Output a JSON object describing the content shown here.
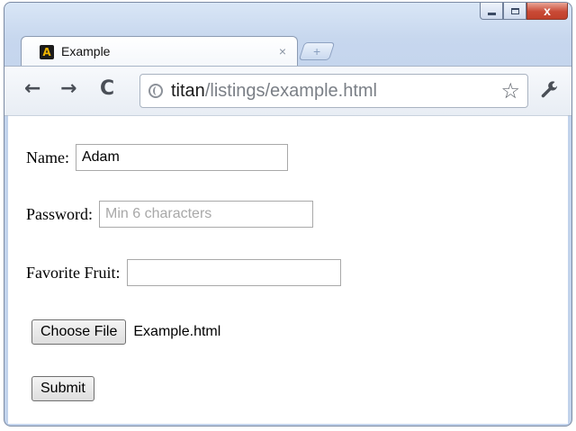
{
  "window": {
    "tab_title": "Example",
    "tab_close": "×",
    "new_tab": "+",
    "close_glyph": "x"
  },
  "toolbar": {
    "back": "←",
    "forward": "→",
    "reload": "C",
    "url_host": "titan",
    "url_path": "/listings/example.html",
    "bookmark": "☆",
    "wrench": "🔧"
  },
  "form": {
    "name_label": "Name:",
    "name_value": "Adam",
    "password_label": "Password:",
    "password_placeholder": "Min 6 characters",
    "fruit_label": "Favorite Fruit:",
    "fruit_value": "",
    "choose_file_label": "Choose File",
    "file_name": "Example.html",
    "submit_label": "Submit"
  },
  "icons": {
    "favicon": "a-logo-icon",
    "back": "arrow-left-icon",
    "forward": "arrow-right-icon",
    "reload": "reload-icon",
    "site": "globe-icon",
    "bookmark": "star-icon",
    "menu": "wrench-icon"
  }
}
